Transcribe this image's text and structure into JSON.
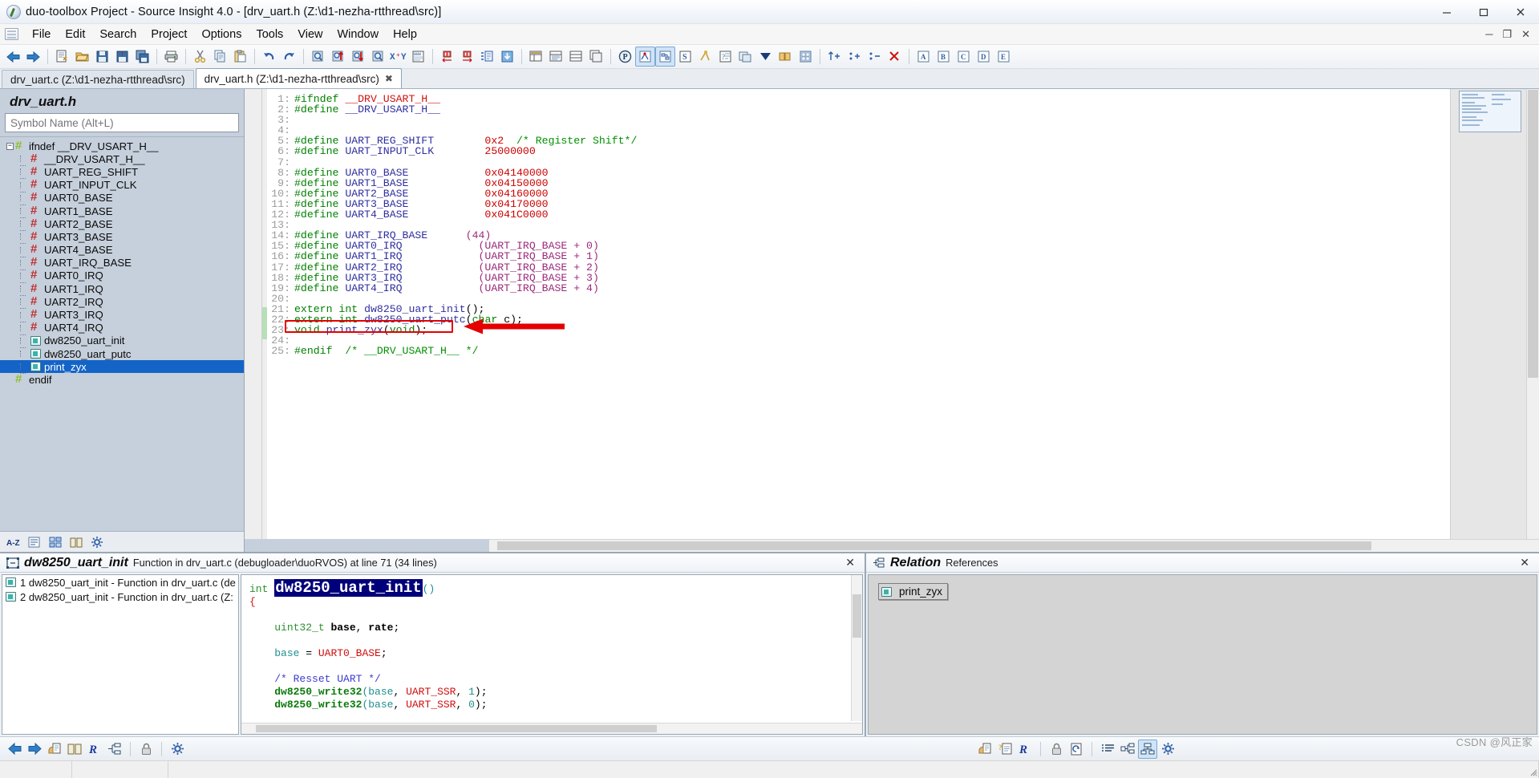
{
  "window": {
    "title": "duo-toolbox Project - Source Insight 4.0 - [drv_uart.h (Z:\\d1-nezha-rtthread\\src)]",
    "app_icon": "source-insight-logo-icon",
    "minimize_label": "─",
    "maximize_label": "❐",
    "close_label": "✕",
    "inner_minimize_label": "─",
    "inner_restore_label": "❐",
    "inner_close_label": "✕"
  },
  "menubar": {
    "doc_icon": "document-icon",
    "items": [
      {
        "label": "File",
        "name": "menu-file"
      },
      {
        "label": "Edit",
        "name": "menu-edit"
      },
      {
        "label": "Search",
        "name": "menu-search"
      },
      {
        "label": "Project",
        "name": "menu-project"
      },
      {
        "label": "Options",
        "name": "menu-options"
      },
      {
        "label": "Tools",
        "name": "menu-tools"
      },
      {
        "label": "View",
        "name": "menu-view"
      },
      {
        "label": "Window",
        "name": "menu-window"
      },
      {
        "label": "Help",
        "name": "menu-help"
      }
    ]
  },
  "toolbar": {
    "groups": [
      [
        "back-icon",
        "forward-icon"
      ],
      [
        "new-file-icon",
        "open-file-icon",
        "save-icon",
        "save-as-icon",
        "save-all-icon"
      ],
      [
        "print-icon"
      ],
      [
        "cut-icon",
        "copy-icon",
        "paste-icon"
      ],
      [
        "undo-icon",
        "redo-icon"
      ],
      [
        "search-icon",
        "search-backward-icon",
        "search-forward-icon",
        "search-files-icon",
        "replace-icon",
        "search-web-icon"
      ],
      [
        "bookmark-left-icon",
        "bookmark-right-icon",
        "indent-icon",
        "outdent-icon"
      ],
      [
        "symbol-window-icon",
        "context-window-icon",
        "file-list-icon",
        "clip-window-icon"
      ],
      [
        "project-icon",
        "relation-window-icon",
        "relation-graph-icon",
        "symbol-info-icon",
        "jump-icon",
        "browse-icon",
        "callers-icon",
        "smart-rename-icon",
        "doc-options-icon",
        "file-props-icon"
      ],
      [
        "add-file-icon",
        "add-all-icon",
        "remove-file-icon",
        "remove-all-icon"
      ],
      [
        "panel-a-icon",
        "panel-b-icon",
        "panel-c-icon",
        "panel-d-icon",
        "panel-e-icon"
      ]
    ]
  },
  "file_tabs": [
    {
      "label": "drv_uart.c (Z:\\d1-nezha-rtthread\\src)",
      "active": false,
      "closable": false
    },
    {
      "label": "drv_uart.h (Z:\\d1-nezha-rtthread\\src)",
      "active": true,
      "closable": true,
      "close_label": "✖"
    }
  ],
  "symbol_pane": {
    "title": "drv_uart.h",
    "search_placeholder": "Symbol Name (Alt+L)",
    "search_value": "",
    "tree": [
      {
        "label": "ifndef __DRV_USART_H__",
        "icon": "hash-green-icon",
        "depth": 0,
        "expander": "−",
        "selected": false
      },
      {
        "label": "__DRV_USART_H__",
        "icon": "hash-icon",
        "depth": 1,
        "selected": false
      },
      {
        "label": "UART_REG_SHIFT",
        "icon": "hash-icon",
        "depth": 1,
        "selected": false
      },
      {
        "label": "UART_INPUT_CLK",
        "icon": "hash-icon",
        "depth": 1,
        "selected": false
      },
      {
        "label": "UART0_BASE",
        "icon": "hash-icon",
        "depth": 1,
        "selected": false
      },
      {
        "label": "UART1_BASE",
        "icon": "hash-icon",
        "depth": 1,
        "selected": false
      },
      {
        "label": "UART2_BASE",
        "icon": "hash-icon",
        "depth": 1,
        "selected": false
      },
      {
        "label": "UART3_BASE",
        "icon": "hash-icon",
        "depth": 1,
        "selected": false
      },
      {
        "label": "UART4_BASE",
        "icon": "hash-icon",
        "depth": 1,
        "selected": false
      },
      {
        "label": "UART_IRQ_BASE",
        "icon": "hash-icon",
        "depth": 1,
        "selected": false
      },
      {
        "label": "UART0_IRQ",
        "icon": "hash-icon",
        "depth": 1,
        "selected": false
      },
      {
        "label": "UART1_IRQ",
        "icon": "hash-icon",
        "depth": 1,
        "selected": false
      },
      {
        "label": "UART2_IRQ",
        "icon": "hash-icon",
        "depth": 1,
        "selected": false
      },
      {
        "label": "UART3_IRQ",
        "icon": "hash-icon",
        "depth": 1,
        "selected": false
      },
      {
        "label": "UART4_IRQ",
        "icon": "hash-icon",
        "depth": 1,
        "selected": false
      },
      {
        "label": "dw8250_uart_init",
        "icon": "function-icon",
        "depth": 1,
        "selected": false
      },
      {
        "label": "dw8250_uart_putc",
        "icon": "function-icon",
        "depth": 1,
        "selected": false
      },
      {
        "label": "print_zyx",
        "icon": "function-icon",
        "depth": 1,
        "selected": true
      },
      {
        "label": "endif",
        "icon": "hash-green-icon",
        "depth": 0,
        "selected": false
      }
    ],
    "bottom_buttons": [
      "sort-alpha-icon",
      "flat-list-icon",
      "group-icon",
      "book-icon",
      "settings-icon"
    ]
  },
  "editor": {
    "lines": [
      {
        "n": "1",
        "tokens": [
          {
            "t": "#ifndef ",
            "c": "kw"
          },
          {
            "t": "__DRV_USART_H__",
            "c": "red"
          }
        ]
      },
      {
        "n": "2",
        "tokens": [
          {
            "t": "#define ",
            "c": "kw"
          },
          {
            "t": "__DRV_USART_H__",
            "c": "id"
          }
        ]
      },
      {
        "n": "3",
        "tokens": []
      },
      {
        "n": "4",
        "tokens": []
      },
      {
        "n": "5",
        "tokens": [
          {
            "t": "#define ",
            "c": "kw"
          },
          {
            "t": "UART_REG_SHIFT",
            "c": "id"
          },
          {
            "t": "        ",
            "c": "pl"
          },
          {
            "t": "0x2",
            "c": "num"
          },
          {
            "t": "  ",
            "c": "pl"
          },
          {
            "t": "/* Register Shift*/",
            "c": "cmt"
          }
        ]
      },
      {
        "n": "6",
        "tokens": [
          {
            "t": "#define ",
            "c": "kw"
          },
          {
            "t": "UART_INPUT_CLK",
            "c": "id"
          },
          {
            "t": "        ",
            "c": "pl"
          },
          {
            "t": "25000000",
            "c": "num"
          }
        ]
      },
      {
        "n": "7",
        "tokens": []
      },
      {
        "n": "8",
        "tokens": [
          {
            "t": "#define ",
            "c": "kw"
          },
          {
            "t": "UART0_BASE",
            "c": "id"
          },
          {
            "t": "            ",
            "c": "pl"
          },
          {
            "t": "0x04140000",
            "c": "num"
          }
        ]
      },
      {
        "n": "9",
        "tokens": [
          {
            "t": "#define ",
            "c": "kw"
          },
          {
            "t": "UART1_BASE",
            "c": "id"
          },
          {
            "t": "            ",
            "c": "pl"
          },
          {
            "t": "0x04150000",
            "c": "num"
          }
        ]
      },
      {
        "n": "10",
        "tokens": [
          {
            "t": "#define ",
            "c": "kw"
          },
          {
            "t": "UART2_BASE",
            "c": "id"
          },
          {
            "t": "            ",
            "c": "pl"
          },
          {
            "t": "0x04160000",
            "c": "num"
          }
        ]
      },
      {
        "n": "11",
        "tokens": [
          {
            "t": "#define ",
            "c": "kw"
          },
          {
            "t": "UART3_BASE",
            "c": "id"
          },
          {
            "t": "            ",
            "c": "pl"
          },
          {
            "t": "0x04170000",
            "c": "num"
          }
        ]
      },
      {
        "n": "12",
        "tokens": [
          {
            "t": "#define ",
            "c": "kw"
          },
          {
            "t": "UART4_BASE",
            "c": "id"
          },
          {
            "t": "            ",
            "c": "pl"
          },
          {
            "t": "0x041C0000",
            "c": "num"
          }
        ]
      },
      {
        "n": "13",
        "tokens": []
      },
      {
        "n": "14",
        "tokens": [
          {
            "t": "#define ",
            "c": "kw"
          },
          {
            "t": "UART_IRQ_BASE",
            "c": "id"
          },
          {
            "t": "      ",
            "c": "pl"
          },
          {
            "t": "(44)",
            "c": "mac"
          }
        ]
      },
      {
        "n": "15",
        "tokens": [
          {
            "t": "#define ",
            "c": "kw"
          },
          {
            "t": "UART0_IRQ",
            "c": "id"
          },
          {
            "t": "            ",
            "c": "pl"
          },
          {
            "t": "(UART_IRQ_BASE + 0)",
            "c": "mac"
          }
        ]
      },
      {
        "n": "16",
        "tokens": [
          {
            "t": "#define ",
            "c": "kw"
          },
          {
            "t": "UART1_IRQ",
            "c": "id"
          },
          {
            "t": "            ",
            "c": "pl"
          },
          {
            "t": "(UART_IRQ_BASE + 1)",
            "c": "mac"
          }
        ]
      },
      {
        "n": "17",
        "tokens": [
          {
            "t": "#define ",
            "c": "kw"
          },
          {
            "t": "UART2_IRQ",
            "c": "id"
          },
          {
            "t": "            ",
            "c": "pl"
          },
          {
            "t": "(UART_IRQ_BASE + 2)",
            "c": "mac"
          }
        ]
      },
      {
        "n": "18",
        "tokens": [
          {
            "t": "#define ",
            "c": "kw"
          },
          {
            "t": "UART3_IRQ",
            "c": "id"
          },
          {
            "t": "            ",
            "c": "pl"
          },
          {
            "t": "(UART_IRQ_BASE + 3)",
            "c": "mac"
          }
        ]
      },
      {
        "n": "19",
        "tokens": [
          {
            "t": "#define ",
            "c": "kw"
          },
          {
            "t": "UART4_IRQ",
            "c": "id"
          },
          {
            "t": "            ",
            "c": "pl"
          },
          {
            "t": "(UART_IRQ_BASE + 4)",
            "c": "mac"
          }
        ]
      },
      {
        "n": "20",
        "tokens": []
      },
      {
        "n": "21",
        "tokens": [
          {
            "t": "extern ",
            "c": "kw"
          },
          {
            "t": "int",
            "c": "kw"
          },
          {
            "t": " ",
            "c": "pl"
          },
          {
            "t": "dw8250_uart_init",
            "c": "id"
          },
          {
            "t": "();",
            "c": "pl"
          }
        ]
      },
      {
        "n": "22",
        "tokens": [
          {
            "t": "extern ",
            "c": "kw"
          },
          {
            "t": "int",
            "c": "kw"
          },
          {
            "t": " ",
            "c": "pl"
          },
          {
            "t": "dw8250_uart_putc",
            "c": "id"
          },
          {
            "t": "(",
            "c": "pl"
          },
          {
            "t": "char",
            "c": "kw"
          },
          {
            "t": " c);",
            "c": "pl"
          }
        ]
      },
      {
        "n": "23",
        "tokens": [
          {
            "t": "void",
            "c": "kw"
          },
          {
            "t": " ",
            "c": "pl"
          },
          {
            "t": "print_zyx",
            "c": "id"
          },
          {
            "t": "(",
            "c": "pl"
          },
          {
            "t": "void",
            "c": "kw"
          },
          {
            "t": ");",
            "c": "pl"
          }
        ]
      },
      {
        "n": "24",
        "tokens": []
      },
      {
        "n": "25",
        "tokens": [
          {
            "t": "#endif",
            "c": "kw"
          },
          {
            "t": "  ",
            "c": "pl"
          },
          {
            "t": "/* __DRV_USART_H__ */",
            "c": "cmt"
          }
        ]
      }
    ],
    "annotation": {
      "box_label": "red-highlight-box-line-23",
      "arrow_label": "red-pointer-arrow",
      "color": "#e40000"
    }
  },
  "context_window": {
    "icon": "context-window-icon",
    "title": "dw8250_uart_init",
    "subtitle": "Function in drv_uart.c (debugloader\\duoRVOS) at line 71 (34 lines)",
    "close_label": "✕",
    "list": [
      {
        "num": "1",
        "text": "dw8250_uart_init - Function in drv_uart.c (de",
        "icon": "file-symbol-icon"
      },
      {
        "num": "2",
        "text": "dw8250_uart_init - Function in drv_uart.c (Z:",
        "icon": "file-symbol-icon"
      }
    ],
    "preview_lines": [
      [
        {
          "t": "int ",
          "c": "gkw"
        },
        {
          "t": "dw8250_uart_init",
          "c": "big"
        },
        {
          "t": "()",
          "c": "tealv"
        }
      ],
      [
        {
          "t": "{",
          "c": "rd"
        }
      ],
      [
        {
          "t": "",
          "c": "pl"
        }
      ],
      [
        {
          "t": "    ",
          "c": "pl"
        },
        {
          "t": "uint32_t",
          "c": "gkw"
        },
        {
          "t": " ",
          "c": "pl"
        },
        {
          "t": "base",
          "c": "bold"
        },
        {
          "t": ", ",
          "c": "pl"
        },
        {
          "t": "rate",
          "c": "bold"
        },
        {
          "t": ";",
          "c": "pl"
        }
      ],
      [
        {
          "t": "",
          "c": "pl"
        }
      ],
      [
        {
          "t": "    ",
          "c": "pl"
        },
        {
          "t": "base",
          "c": "tealv"
        },
        {
          "t": " = ",
          "c": "pl"
        },
        {
          "t": "UART0_BASE",
          "c": "rd"
        },
        {
          "t": ";",
          "c": "pl"
        }
      ],
      [
        {
          "t": "",
          "c": "pl"
        }
      ],
      [
        {
          "t": "    ",
          "c": "pl"
        },
        {
          "t": "/* Resset UART */",
          "c": "cmtb"
        }
      ],
      [
        {
          "t": "    ",
          "c": "pl"
        },
        {
          "t": "dw8250_write32",
          "c": "fn"
        },
        {
          "t": "(",
          "c": "tealv"
        },
        {
          "t": "base",
          "c": "tealv"
        },
        {
          "t": ", ",
          "c": "pl"
        },
        {
          "t": "UART_SSR",
          "c": "rd"
        },
        {
          "t": ", ",
          "c": "pl"
        },
        {
          "t": "1",
          "c": "tealv"
        },
        {
          "t": ");",
          "c": "pl"
        }
      ],
      [
        {
          "t": "    ",
          "c": "pl"
        },
        {
          "t": "dw8250_write32",
          "c": "fn"
        },
        {
          "t": "(",
          "c": "tealv"
        },
        {
          "t": "base",
          "c": "tealv"
        },
        {
          "t": ", ",
          "c": "pl"
        },
        {
          "t": "UART_SSR",
          "c": "rd"
        },
        {
          "t": ", ",
          "c": "pl"
        },
        {
          "t": "0",
          "c": "tealv"
        },
        {
          "t": ");",
          "c": "pl"
        }
      ]
    ],
    "toolbar_buttons": [
      "back-icon",
      "forward-icon",
      "highlight-icon",
      "book-icon",
      "relation-icon",
      "outline-icon",
      "lock-icon",
      "settings-icon"
    ]
  },
  "relation_window": {
    "icon": "relation-graph-icon",
    "title": "Relation",
    "subtitle": "References",
    "close_label": "✕",
    "node_label": "print_zyx",
    "node_icon": "file-symbol-icon",
    "toolbar_buttons": [
      "highlight-icon",
      "help-doc-icon",
      "relation-icon",
      "lock-icon",
      "refresh-icon",
      "list-view-icon",
      "horizontal-tree-icon",
      "vertical-tree-icon",
      "settings-icon"
    ]
  },
  "watermark": "CSDN @风正家"
}
